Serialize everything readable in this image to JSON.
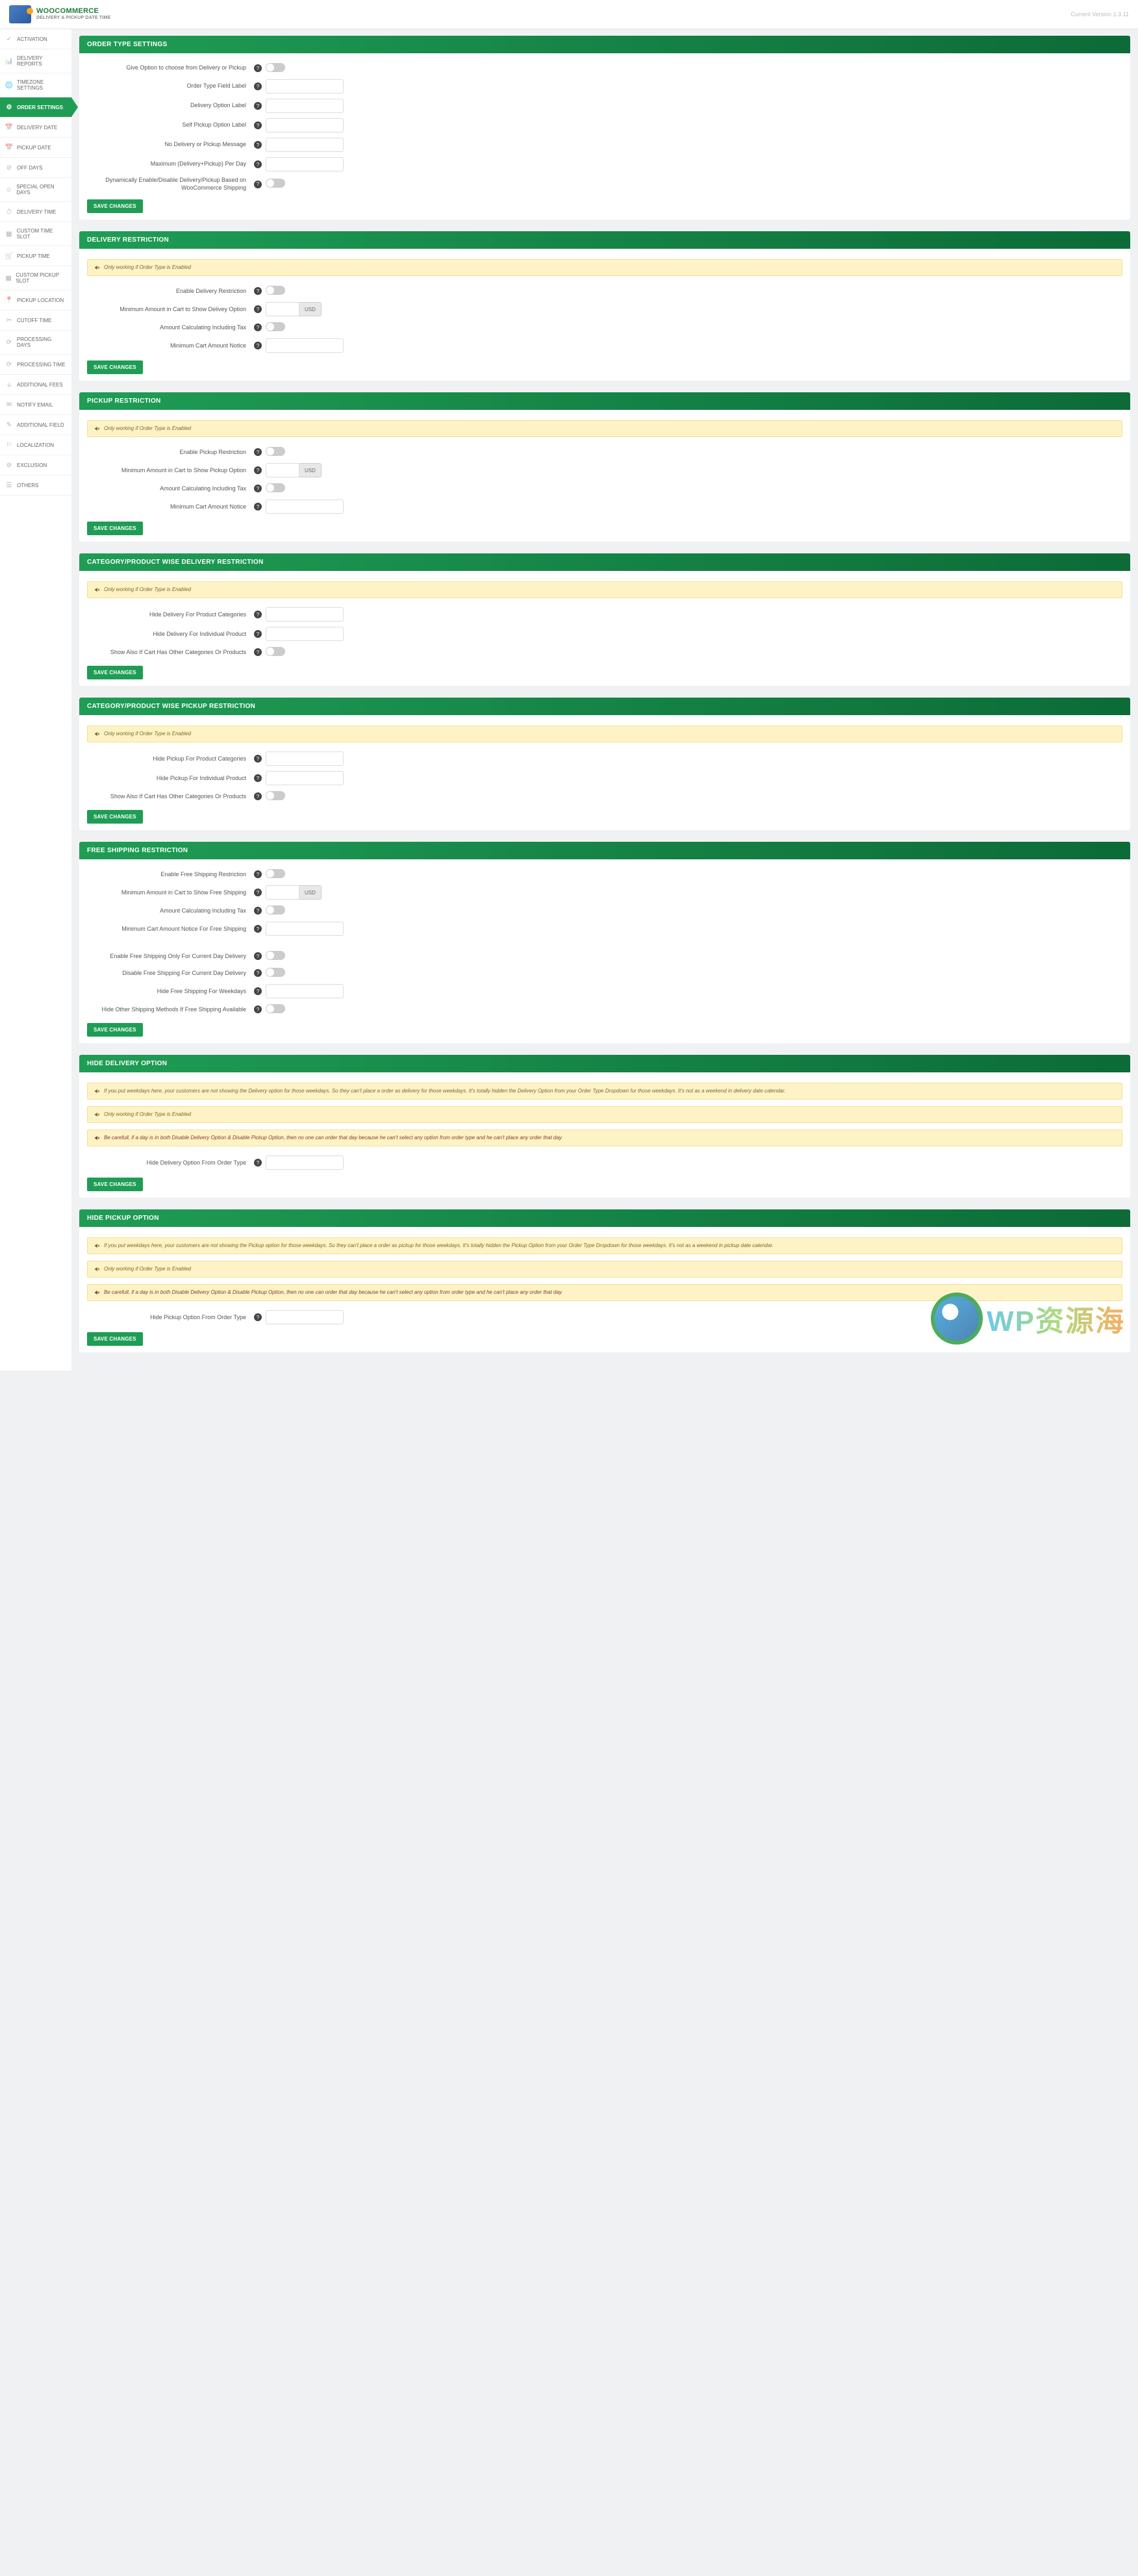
{
  "header": {
    "brand_title": "WOOCOMMERCE",
    "brand_sub": "DELIVERY & PICKUP DATE TIME",
    "version": "Current Version 1.3.11"
  },
  "sidebar": {
    "items": [
      {
        "icon": "✓",
        "label": "ACTIVATION"
      },
      {
        "icon": "📊",
        "label": "DELIVERY REPORTS"
      },
      {
        "icon": "🌐",
        "label": "TIMEZONE SETTINGS"
      },
      {
        "icon": "⚙",
        "label": "ORDER SETTINGS",
        "active": true
      },
      {
        "icon": "📅",
        "label": "DELIVERY DATE"
      },
      {
        "icon": "📅",
        "label": "PICKUP DATE"
      },
      {
        "icon": "⊘",
        "label": "OFF DAYS"
      },
      {
        "icon": "☺",
        "label": "SPECIAL OPEN DAYS"
      },
      {
        "icon": "⏱",
        "label": "DELIVERY TIME"
      },
      {
        "icon": "▦",
        "label": "CUSTOM TIME SLOT"
      },
      {
        "icon": "🛒",
        "label": "PICKUP TIME"
      },
      {
        "icon": "▦",
        "label": "CUSTOM PICKUP SLOT"
      },
      {
        "icon": "📍",
        "label": "PICKUP LOCATION"
      },
      {
        "icon": "✂",
        "label": "CUTOFF TIME"
      },
      {
        "icon": "⟳",
        "label": "PROCESSING DAYS"
      },
      {
        "icon": "⟳",
        "label": "PROCESSING TIME"
      },
      {
        "icon": "＋",
        "label": "ADDITIONAL FEES"
      },
      {
        "icon": "✉",
        "label": "NOTIFY EMAIL"
      },
      {
        "icon": "✎",
        "label": "ADDITIONAL FIELD"
      },
      {
        "icon": "⚐",
        "label": "LOCALIZATION"
      },
      {
        "icon": "⊘",
        "label": "EXCLUSION"
      },
      {
        "icon": "☰",
        "label": "OTHERS"
      }
    ]
  },
  "common": {
    "save": "SAVE CHANGES",
    "help": "?",
    "only_working": "Only working if Order Type is Enabled",
    "usd": "USD"
  },
  "panels": [
    {
      "title": "ORDER TYPE SETTINGS",
      "fields": [
        {
          "label": "Give Option to choose from Delivery or Pickup",
          "type": "toggle"
        },
        {
          "label": "Order Type Field Label",
          "type": "text"
        },
        {
          "label": "Delivery Option Label",
          "type": "text"
        },
        {
          "label": "Self Pickup Option Label",
          "type": "text"
        },
        {
          "label": "No Delivery or Pickup Message",
          "type": "text"
        },
        {
          "label": "Maximum (Delivery+Pickup) Per Day",
          "type": "text"
        },
        {
          "label": "Dynamically Enable/Disable Delivery/Pickup Based on WooCommerce Shipping",
          "type": "toggle"
        }
      ]
    },
    {
      "title": "DELIVERY RESTRICTION",
      "info": true,
      "fields": [
        {
          "label": "Enable Delivery Restriction",
          "type": "toggle"
        },
        {
          "label": "Minimum Amount in Cart to Show Delivey Option",
          "type": "money"
        },
        {
          "label": "Amount Calculating Including Tax",
          "type": "toggle"
        },
        {
          "label": "Minimum Cart Amount Notice",
          "type": "text"
        }
      ]
    },
    {
      "title": "PICKUP RESTRICTION",
      "info": true,
      "fields": [
        {
          "label": "Enable Pickup Restriction",
          "type": "toggle"
        },
        {
          "label": "Minimum Amount in Cart to Show Pickup Option",
          "type": "money"
        },
        {
          "label": "Amount Calculating Including Tax",
          "type": "toggle"
        },
        {
          "label": "Minimum Cart Amount Notice",
          "type": "text"
        }
      ]
    },
    {
      "title": "CATEGORY/PRODUCT WISE DELIVERY RESTRICTION",
      "info": true,
      "fields": [
        {
          "label": "Hide Delivery For Product Categories",
          "type": "text"
        },
        {
          "label": "Hide Delivery For Individual Product",
          "type": "text"
        },
        {
          "label": "Show Also If Cart Has Other Categories Or Products",
          "type": "toggle"
        }
      ]
    },
    {
      "title": "CATEGORY/PRODUCT WISE PICKUP RESTRICTION",
      "info": true,
      "fields": [
        {
          "label": "Hide Pickup For Product Categories",
          "type": "text"
        },
        {
          "label": "Hide Pickup For Individual Product",
          "type": "text"
        },
        {
          "label": "Show Also If Cart Has Other Categories Or Products",
          "type": "toggle"
        }
      ]
    },
    {
      "title": "FREE SHIPPING RESTRICTION",
      "fields": [
        {
          "label": "Enable Free Shipping Restriction",
          "type": "toggle"
        },
        {
          "label": "Minimum Amount in Cart to Show Free Shipping",
          "type": "money"
        },
        {
          "label": "Amount Calculating Including Tax",
          "type": "toggle"
        },
        {
          "label": "Minimum Cart Amount Notice For Free Shipping",
          "type": "text"
        },
        {
          "gap": true
        },
        {
          "label": "Enable Free Shipping Only For Current Day Delivery",
          "type": "toggle"
        },
        {
          "label": "Disable Free Shipping For Current Day Delivery",
          "type": "toggle"
        },
        {
          "label": "Hide Free Shipping For Weekdays",
          "type": "text"
        },
        {
          "label": "Hide Other Shipping Methods If Free Shipping Available",
          "type": "toggle"
        }
      ]
    },
    {
      "title": "HIDE DELIVERY OPTION",
      "long_info": "If you put weekdays here, your customers are not showing the Delivery option for those weekdays. So they can't place a order as delivery for those weekdays. It's totally hidden the Delivery Option from your Order Type Dropdown for those weekdays. It's not as a weekend in delivery date calendar.",
      "info": true,
      "careful": "Be carefull, if a day is in both Disable Delivery Option & Disable Pickup Option, then no one can order that day because he can't select any option from order type and he can't place any order that day.",
      "fields": [
        {
          "label": "Hide Delivery Option From Order Type",
          "type": "text"
        }
      ]
    },
    {
      "title": "HIDE PICKUP OPTION",
      "long_info": "If you put weekdays here, your customers are not showing the Pickup option for those weekdays. So they can't place a order as pickup for those weekdays. It's totally hidden the Pickup Option from your Order Type Dropdown for those weekdays. It's not as a weekend in pickup date calendar.",
      "info": true,
      "careful": "Be carefull, if a day is in both Disable Delivery Option & Disable Pickup Option, then no one can order that day because he can't select any option from order type and he can't place any order that day.",
      "fields": [
        {
          "label": "Hide Pickup Option From Order Type",
          "type": "text"
        }
      ]
    }
  ],
  "watermark": "WP资源海"
}
